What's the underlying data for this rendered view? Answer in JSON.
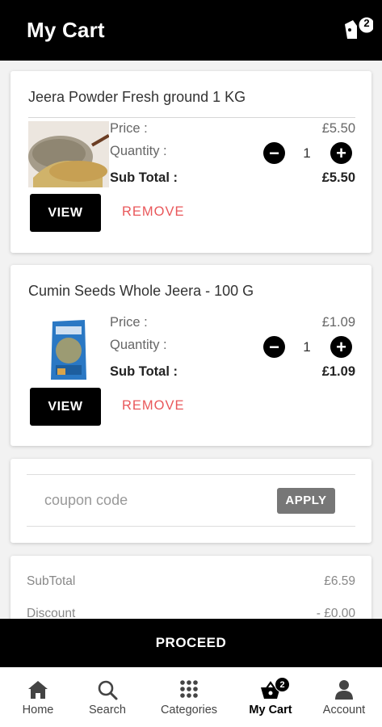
{
  "header": {
    "title": "My Cart",
    "cart_count": "2"
  },
  "items": [
    {
      "name": "Jeera Powder Fresh ground 1 KG",
      "price_label": "Price :",
      "price": "£5.50",
      "quantity_label": "Quantity :",
      "quantity": "1",
      "subtotal_label": "Sub Total :",
      "subtotal": "£5.50",
      "view_label": "VIEW",
      "remove_label": "REMOVE"
    },
    {
      "name": "Cumin Seeds Whole Jeera - 100 G",
      "price_label": "Price :",
      "price": "£1.09",
      "quantity_label": "Quantity :",
      "quantity": "1",
      "subtotal_label": "Sub Total :",
      "subtotal": "£1.09",
      "view_label": "VIEW",
      "remove_label": "REMOVE"
    }
  ],
  "coupon": {
    "placeholder": "coupon code",
    "apply_label": "APPLY"
  },
  "summary": {
    "subtotal_label": "SubTotal",
    "subtotal_value": "£6.59",
    "discount_label": "Discount",
    "discount_value": "- £0.00"
  },
  "proceed_label": "PROCEED",
  "bottom_nav": {
    "items": [
      {
        "label": "Home",
        "icon": "home-icon"
      },
      {
        "label": "Search",
        "icon": "search-icon"
      },
      {
        "label": "Categories",
        "icon": "grid-icon"
      },
      {
        "label": "My Cart",
        "icon": "basket-icon",
        "badge": "2",
        "active": true
      },
      {
        "label": "Account",
        "icon": "person-icon"
      }
    ]
  },
  "colors": {
    "accent": "#000000",
    "remove": "#e9575a",
    "apply": "#777777"
  }
}
